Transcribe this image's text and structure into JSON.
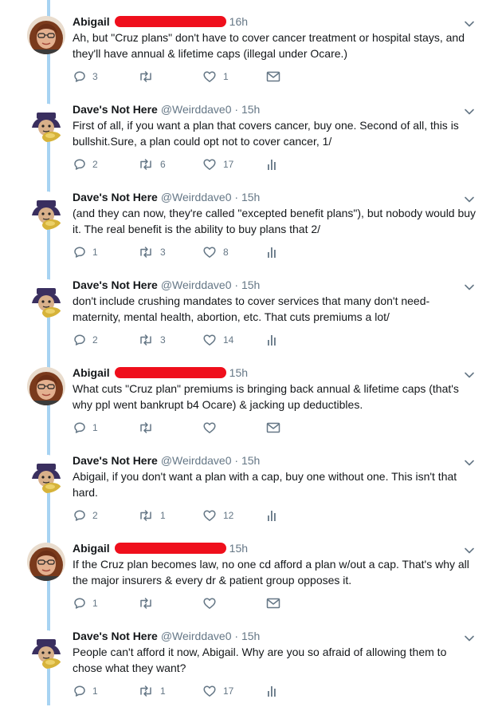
{
  "colors": {
    "thread_line": "#a7d3f2",
    "redaction": "#ef0f1c",
    "muted": "#657786",
    "text": "#14171a"
  },
  "tweets": [
    {
      "author": "Abigail",
      "handle": "",
      "time": "16h",
      "redacted": true,
      "redact_width": 140,
      "avatar": "abigail-avatar",
      "text": "Ah, but \"Cruz plans\" don't have to cover cancer treatment or hospital stays, and they'll have annual & lifetime caps (illegal under Ocare.)",
      "replies": "3",
      "retweets": "",
      "likes": "1",
      "extra": "mail"
    },
    {
      "author": "Dave's Not Here",
      "handle": "@Weirddave0",
      "time": "· 15h",
      "redacted": false,
      "avatar": "dave-avatar",
      "text": "First of all, if you want a plan that covers cancer, buy one. Second of all, this is bullshit.Sure, a plan could opt not to cover cancer, 1/",
      "replies": "2",
      "retweets": "6",
      "likes": "17",
      "extra": "analytics"
    },
    {
      "author": "Dave's Not Here",
      "handle": "@Weirddave0",
      "time": "· 15h",
      "redacted": false,
      "avatar": "dave-avatar",
      "text": "(and they can now, they're called \"excepted benefit plans\"), but nobody would buy it. The real benefit is the ability to buy plans that 2/",
      "replies": "1",
      "retweets": "3",
      "likes": "8",
      "extra": "analytics"
    },
    {
      "author": "Dave's Not Here",
      "handle": "@Weirddave0",
      "time": "· 15h",
      "redacted": false,
      "avatar": "dave-avatar",
      "text": "don't include crushing mandates to cover services that many don't need- maternity, mental health, abortion, etc. That cuts premiums a lot/",
      "replies": "2",
      "retweets": "3",
      "likes": "14",
      "extra": "analytics"
    },
    {
      "author": "Abigail",
      "handle": "",
      "time": "15h",
      "redacted": true,
      "redact_width": 140,
      "avatar": "abigail-avatar",
      "text": "What cuts \"Cruz plan\" premiums is bringing back annual & lifetime caps (that's why ppl went bankrupt b4 Ocare) & jacking up deductibles.",
      "replies": "1",
      "retweets": "",
      "likes": "",
      "extra": "mail"
    },
    {
      "author": "Dave's Not Here",
      "handle": "@Weirddave0",
      "time": "· 15h",
      "redacted": false,
      "avatar": "dave-avatar",
      "text": "Abigail, if you don't want a plan with a cap, buy one without one. This isn't that hard.",
      "replies": "2",
      "retweets": "1",
      "likes": "12",
      "extra": "analytics"
    },
    {
      "author": "Abigail",
      "handle": "",
      "time": "15h",
      "redacted": true,
      "redact_width": 140,
      "avatar": "abigail-avatar",
      "text": "If the Cruz plan becomes law, no one cd afford a plan w/out a cap. That's why all the major insurers & every dr & patient group opposes it.",
      "replies": "1",
      "retweets": "",
      "likes": "",
      "extra": "mail"
    },
    {
      "author": "Dave's Not Here",
      "handle": "@Weirddave0",
      "time": "· 15h",
      "redacted": false,
      "avatar": "dave-avatar",
      "text": "People can't afford it now, Abigail. Why are you so afraid of allowing them to chose what they want?",
      "replies": "1",
      "retweets": "1",
      "likes": "17",
      "extra": "analytics"
    }
  ]
}
